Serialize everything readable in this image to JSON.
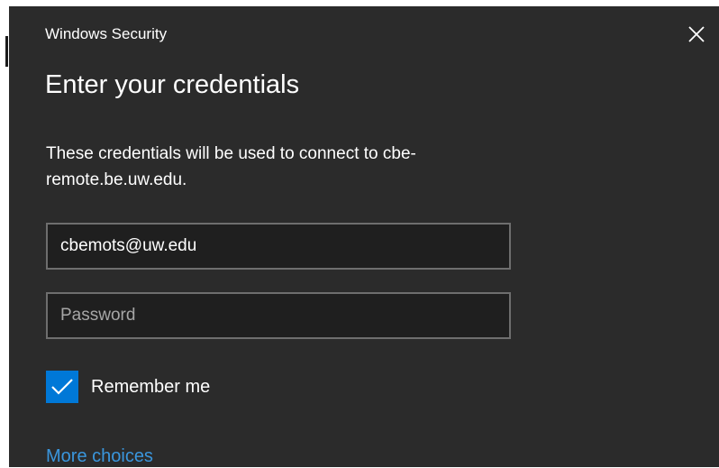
{
  "window": {
    "title": "Windows Security",
    "close_icon": "close-icon"
  },
  "dialog": {
    "heading": "Enter your credentials",
    "message": "These credentials will be used to connect to cbe-remote.be.uw.edu."
  },
  "form": {
    "username_value": "cbemots@uw.edu",
    "password_placeholder": "Password",
    "remember_label": "Remember me",
    "remember_checked": true,
    "more_choices_label": "More choices"
  },
  "colors": {
    "dialog_background": "#2b2b2b",
    "field_background": "#1f1f1f",
    "field_border": "#6e6e6e",
    "accent": "#0078d7",
    "link": "#3a96dd"
  }
}
